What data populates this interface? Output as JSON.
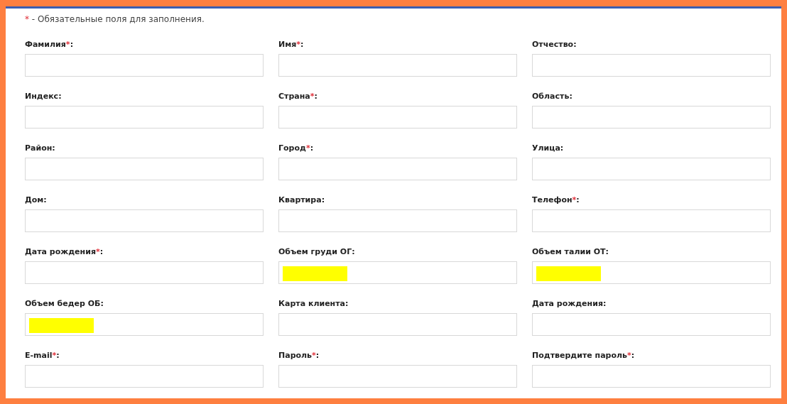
{
  "notice": {
    "mark": "*",
    "text": " - Обязательные поля для заполнения."
  },
  "fields": [
    {
      "label": "Фамилия",
      "required_mark": "*",
      "colon": ":",
      "highlighted": false
    },
    {
      "label": "Имя",
      "required_mark": "*",
      "colon": ":",
      "highlighted": false
    },
    {
      "label": "Отчество",
      "colon": ":",
      "highlighted": false
    },
    {
      "label": "Индекс",
      "colon": ":",
      "highlighted": false
    },
    {
      "label": "Страна",
      "required_mark": "*",
      "colon": ":",
      "highlighted": false
    },
    {
      "label": "Область",
      "colon": ":",
      "highlighted": false
    },
    {
      "label": "Район",
      "colon": ":",
      "highlighted": false
    },
    {
      "label": "Город",
      "required_mark": "*",
      "colon": ":",
      "highlighted": false
    },
    {
      "label": "Улица",
      "colon": ":",
      "highlighted": false
    },
    {
      "label": "Дом",
      "colon": ":",
      "highlighted": false
    },
    {
      "label": "Квартира",
      "colon": ":",
      "highlighted": false
    },
    {
      "label": "Телефон",
      "required_mark": "*",
      "colon": ":",
      "highlighted": false
    },
    {
      "label": "Дата рождения",
      "required_mark": "*",
      "colon": ":",
      "highlighted": false
    },
    {
      "label": "Объем груди ОГ",
      "colon": ":",
      "highlighted": true
    },
    {
      "label": "Объем талии ОТ",
      "colon": ":",
      "highlighted": true
    },
    {
      "label": "Объем бедер ОБ",
      "colon": ":",
      "highlighted": true
    },
    {
      "label": "Карта клиента",
      "colon": ":",
      "highlighted": false
    },
    {
      "label": "Дата рождения",
      "colon": ":",
      "highlighted": false
    },
    {
      "label": "E-mail",
      "required_mark": "*",
      "colon": ":",
      "highlighted": false
    },
    {
      "label": "Пароль",
      "required_mark": "*",
      "colon": ":",
      "highlighted": false
    },
    {
      "label": "Подтвердите пароль",
      "required_mark": "*",
      "colon": ":",
      "highlighted": false
    }
  ]
}
